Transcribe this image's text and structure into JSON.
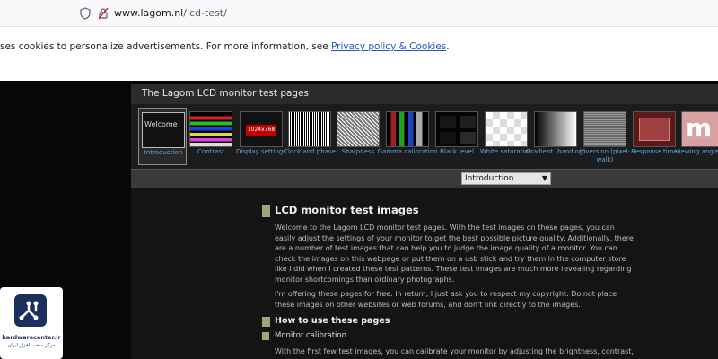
{
  "browser": {
    "url_host": "www.lagom.nl",
    "url_path": "/lcd-test/"
  },
  "cookie_banner": {
    "text": "ses cookies to personalize advertisements. For more information, see ",
    "link": "Privacy policy & Cookies",
    "end": "."
  },
  "site": {
    "title": "The Lagom LCD monitor test pages",
    "thumbnails": [
      {
        "label": "Introduction",
        "text": "Welcome",
        "active": true
      },
      {
        "label": "Contrast"
      },
      {
        "label": "Display settings",
        "text": "1024x768"
      },
      {
        "label": "Clock and phase"
      },
      {
        "label": "Sharpness"
      },
      {
        "label": "Gamma calibration"
      },
      {
        "label": "Black level"
      },
      {
        "label": "White saturation"
      },
      {
        "label": "Gradient (banding)"
      },
      {
        "label": "Inversion (pixel-walk)"
      },
      {
        "label": "Response time"
      },
      {
        "label": "Viewing angle",
        "text": "m"
      }
    ],
    "select_value": "Introduction"
  },
  "content": {
    "heading": "LCD monitor test images",
    "para1": "Welcome to the Lagom LCD monitor test pages. With the test images on these pages, you can easily adjust the settings of your monitor to get the best possible picture quality. Additionally, there are a number of test images that can help you to judge the image quality of a monitor. You can check the images on this webpage or put them on a usb stick and try them in the computer store like I did when I created these test patterns. These test images are much more revealing regarding monitor shortcomings than ordinary photographs.",
    "para2": "I'm offering these pages for free. In return, I just ask you to respect my copyright. Do not place these images on other websites or web forums, and don't link directly to the images.",
    "sub_heading": "How to use these pages",
    "sub_sub_heading": "Monitor calibration",
    "para3": "With the first few test images, you can calibrate your monitor by adjusting the brightness, contrast,"
  },
  "watermark": {
    "name": "hardwarecenter.ir",
    "sub": "مرکز سخت افزار ایران"
  }
}
